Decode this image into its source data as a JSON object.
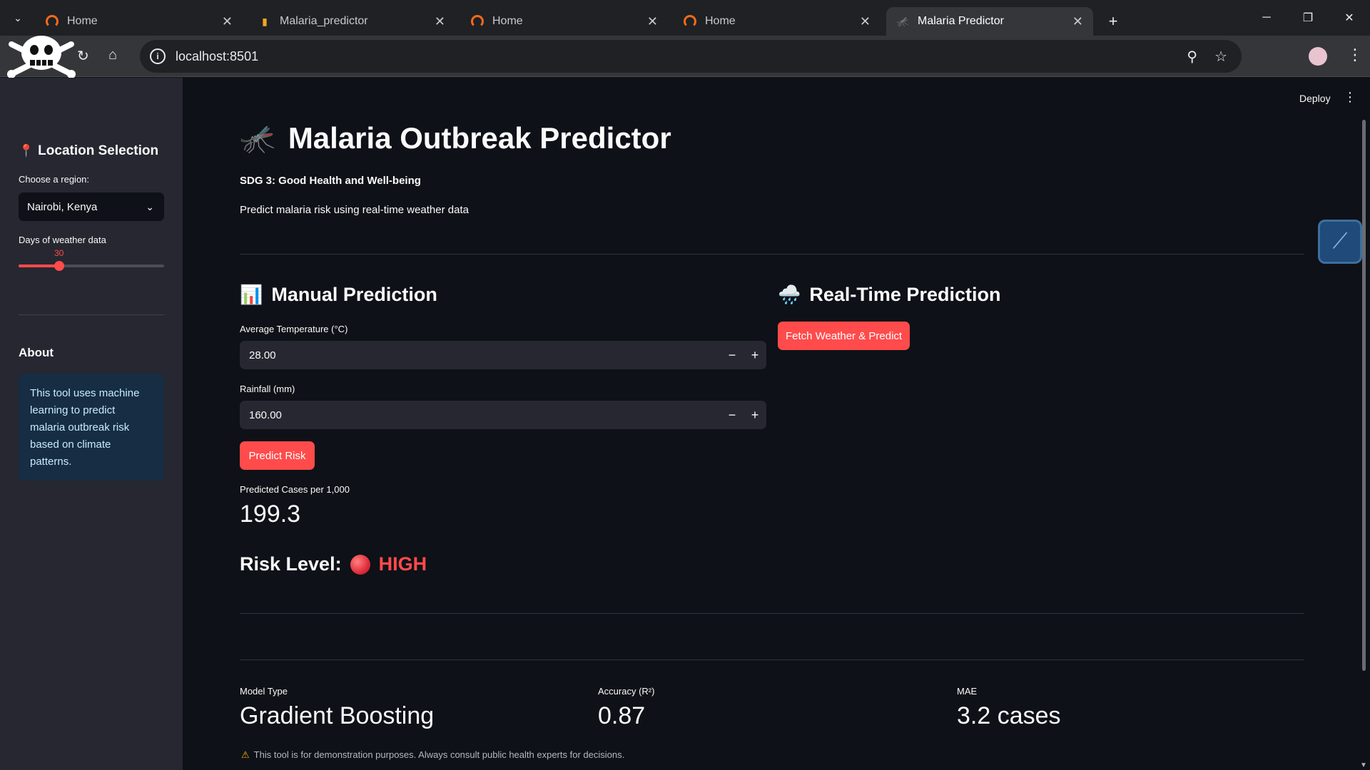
{
  "browser": {
    "tabs": [
      {
        "title": "Home",
        "icon": "ring-icon",
        "active": false
      },
      {
        "title": "Malaria_predictor",
        "icon": "notebook-icon",
        "active": false
      },
      {
        "title": "Home",
        "icon": "ring-icon",
        "active": false
      },
      {
        "title": "Home",
        "icon": "ring-icon",
        "active": false
      },
      {
        "title": "Malaria Predictor",
        "icon": "mosquito-icon",
        "active": true
      }
    ],
    "url": "localhost:8501"
  },
  "sidebar": {
    "location_heading": "Location Selection",
    "region_label": "Choose a region:",
    "region_value": "Nairobi, Kenya",
    "days_label": "Days of weather data",
    "days_value": "30",
    "days_fraction": 0.28,
    "about_heading": "About",
    "about_text": "This tool uses machine learning to predict malaria outbreak risk based on climate patterns."
  },
  "header": {
    "deploy_label": "Deploy"
  },
  "main": {
    "title": "Malaria Outbreak Predictor",
    "sdg_text": "SDG 3: Good Health and Well-being",
    "subtitle": "Predict malaria risk using real-time weather data",
    "manual": {
      "heading": "Manual Prediction",
      "temp_label": "Average Temperature (°C)",
      "temp_value": "28.00",
      "rain_label": "Rainfall (mm)",
      "rain_value": "160.00",
      "predict_button": "Predict Risk",
      "cases_label": "Predicted Cases per 1,000",
      "cases_value": "199.3",
      "risk_label": "Risk Level:",
      "risk_value": "HIGH"
    },
    "realtime": {
      "heading": "Real-Time Prediction",
      "fetch_button": "Fetch Weather & Predict"
    },
    "metrics": [
      {
        "label": "Model Type",
        "value": "Gradient Boosting"
      },
      {
        "label": "Accuracy (R²)",
        "value": "0.87"
      },
      {
        "label": "MAE",
        "value": "3.2 cases"
      }
    ],
    "disclaimer": "This tool is for demonstration purposes. Always consult public health experts for decisions."
  },
  "colors": {
    "accent": "#ff4b4b",
    "background": "#0e1117",
    "sidebar": "#262730",
    "info_box": "#172d43"
  }
}
